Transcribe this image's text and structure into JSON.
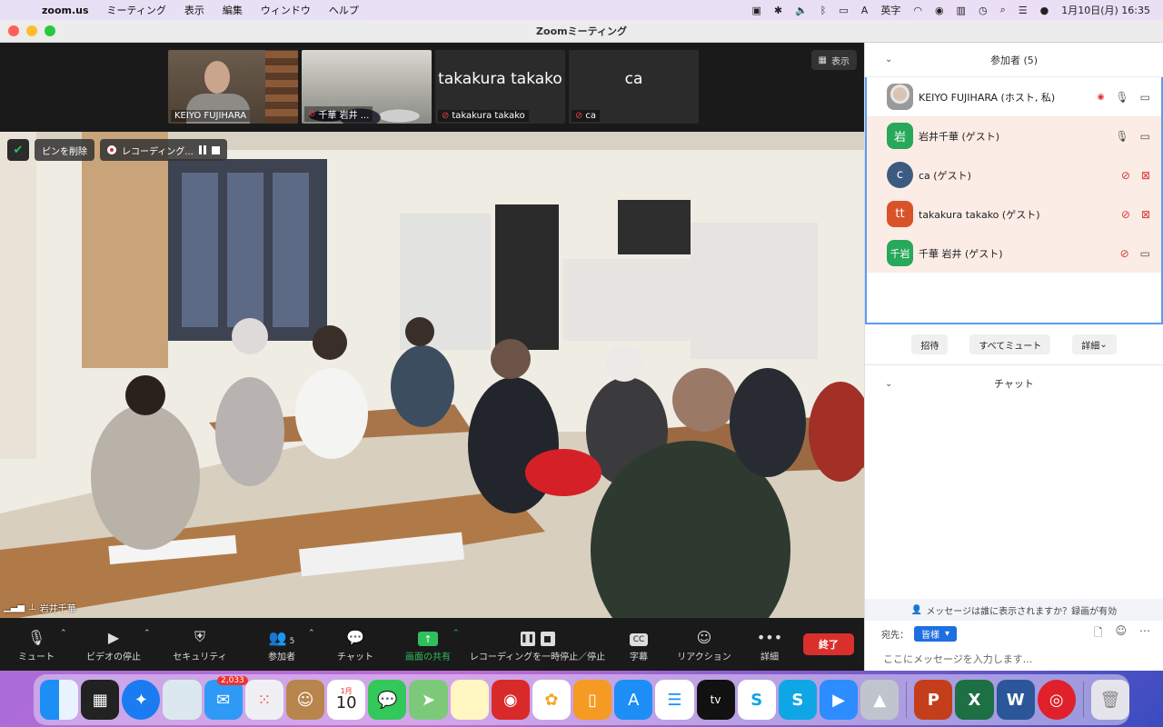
{
  "menubar": {
    "app": "zoom.us",
    "items": [
      "ミーティング",
      "表示",
      "編集",
      "ウィンドウ",
      "ヘルプ"
    ],
    "ime": "英字",
    "datetime": "1月10日(月)  16:35"
  },
  "window": {
    "title": "Zoomミーティング"
  },
  "show_button": "表示",
  "thumbnails": [
    {
      "name": "KEIYO FUJIHARA",
      "muted": false
    },
    {
      "name": "千華 岩井 ...",
      "muted": true
    },
    {
      "name": "takakura takako",
      "muted": true,
      "big": "takakura takako"
    },
    {
      "name": "ca",
      "muted": true,
      "big": "ca"
    }
  ],
  "video": {
    "unpin": "ピンを削除",
    "recording": "レコーディング...",
    "speaker": "岩井千華"
  },
  "toolbar": {
    "mute": "ミュート",
    "video": "ビデオの停止",
    "security": "セキュリティ",
    "participants": "参加者",
    "participants_count": "5",
    "chat": "チャット",
    "share": "画面の共有",
    "record": "レコーディングを一時停止／停止",
    "cc": "字幕",
    "cc_icon": "CC",
    "reaction": "リアクション",
    "more": "詳細",
    "end": "終了"
  },
  "participants_panel": {
    "header": "参加者 (5)",
    "list": [
      {
        "name": "KEIYO FUJIHARA (ホスト, 私)",
        "avatar": "",
        "color": "",
        "muted": false
      },
      {
        "name": "岩井千華 (ゲスト)",
        "avatar": "岩",
        "color": "#27a85a",
        "muted": false
      },
      {
        "name": "ca (ゲスト)",
        "avatar": "c",
        "color": "#3d5a80",
        "muted": true
      },
      {
        "name": "takakura takako (ゲスト)",
        "avatar": "tt",
        "color": "#d9532a",
        "muted": true
      },
      {
        "name": "千華 岩井 (ゲスト)",
        "avatar": "千岩",
        "color": "#27a85a",
        "muted": true
      }
    ],
    "invite": "招待",
    "mute_all": "すべてミュート",
    "more": "詳細"
  },
  "chat_panel": {
    "header": "チャット",
    "notice": "メッセージは誰に表示されますか？録画が有効",
    "to_label": "宛先：",
    "to_value": "皆様",
    "placeholder": "ここにメッセージを入力します..."
  },
  "dock": {
    "mail_badge": "2,033",
    "calendar_month": "1月",
    "calendar_day": "10",
    "tv_label": "tv",
    "icons": [
      "finder-icon",
      "mission-control-icon",
      "safari-icon",
      "preview-icon",
      "mail-icon",
      "launchpad-icon",
      "contacts-icon",
      "calendar-icon",
      "messages-icon",
      "maps-icon",
      "notes-icon",
      "photo-booth-icon",
      "photos-icon",
      "books-icon",
      "app-store-icon",
      "reminders-icon",
      "apple-tv-icon",
      "skype-icon",
      "skype-icon",
      "zoom-icon",
      "parallels-icon",
      "powerpoint-icon",
      "excel-icon",
      "word-icon",
      "security-icon",
      "trash-icon"
    ]
  }
}
